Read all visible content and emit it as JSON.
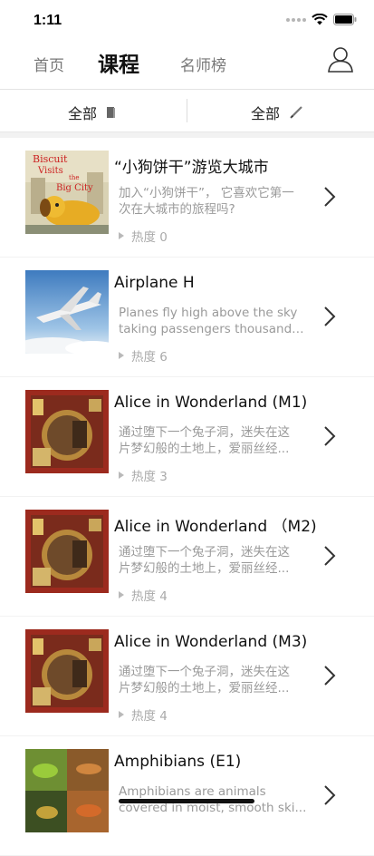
{
  "status": {
    "time": "1:11"
  },
  "nav": {
    "tabs": [
      "首页",
      "课程",
      "名师榜"
    ]
  },
  "filters": [
    {
      "label": "全部",
      "icon": "book-icon"
    },
    {
      "label": "全部",
      "icon": "pencil-icon"
    }
  ],
  "courses": [
    {
      "title": "“小狗饼干”游览大城市",
      "desc1": "加入“小狗饼干”， 它喜欢它第一",
      "desc2": "次在大城市的旅程吗?",
      "heat": "热度 0",
      "thumb_text": [
        "Biscuit",
        "Visits",
        "the",
        "Big City"
      ]
    },
    {
      "title": "Airplane H",
      "desc1": "Planes fly high above the sky",
      "desc2": "taking passengers thousands...",
      "heat": "热度 6"
    },
    {
      "title": "Alice in Wonderland (M1)",
      "desc1": "通过堕下一个兔子洞，迷失在这",
      "desc2": "片梦幻般的土地上，爱丽丝经...",
      "heat": "热度 3"
    },
    {
      "title": "Alice in Wonderland （M2)",
      "desc1": "通过堕下一个兔子洞，迷失在这",
      "desc2": "片梦幻般的土地上，爱丽丝经...",
      "heat": "热度 4"
    },
    {
      "title": "Alice in Wonderland (M3)",
      "desc1": "通过堕下一个兔子洞，迷失在这",
      "desc2": "片梦幻般的土地上，爱丽丝经...",
      "heat": "热度 4"
    },
    {
      "title": "Amphibians (E1)",
      "desc1": "Amphibians are animals",
      "desc2": "covered in moist, smooth ski...",
      "heat": ""
    }
  ]
}
